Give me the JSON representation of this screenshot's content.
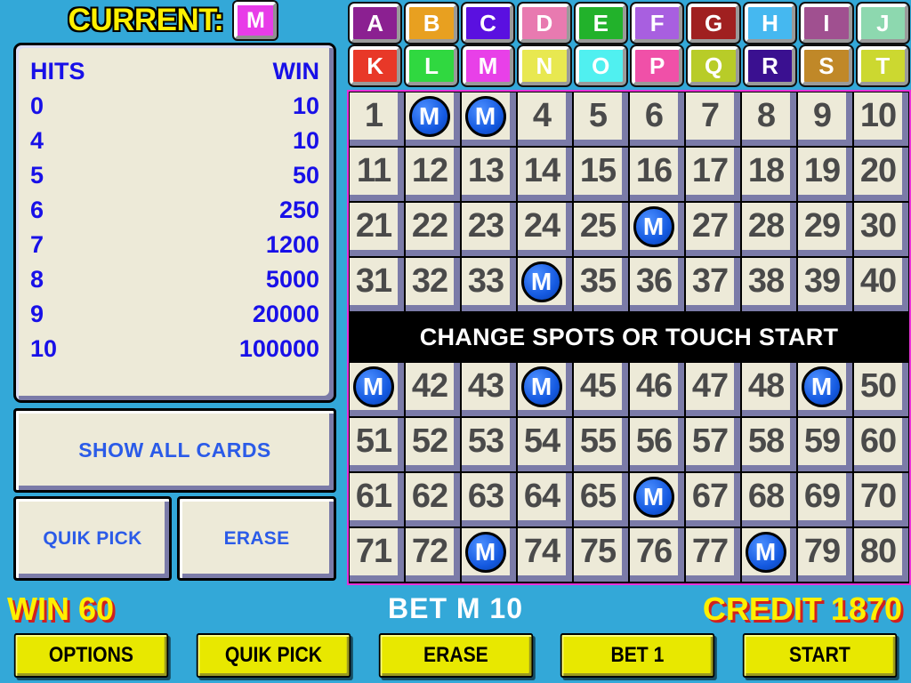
{
  "background_color": "#33A8D8",
  "header": {
    "current_label": "CURRENT:",
    "current_card": "M",
    "current_card_color": "#E83CE8"
  },
  "paytable": {
    "columns": [
      "HITS",
      "WIN"
    ],
    "rows": [
      {
        "hits": "0",
        "win": "10"
      },
      {
        "hits": "4",
        "win": "10"
      },
      {
        "hits": "5",
        "win": "50"
      },
      {
        "hits": "6",
        "win": "250"
      },
      {
        "hits": "7",
        "win": "1200"
      },
      {
        "hits": "8",
        "win": "5000"
      },
      {
        "hits": "9",
        "win": "20000"
      },
      {
        "hits": "10",
        "win": "100000"
      }
    ]
  },
  "left_buttons": {
    "show_all_cards": "SHOW ALL CARDS",
    "quik_pick": "QUIK PICK",
    "erase": "ERASE"
  },
  "card_letters": [
    {
      "label": "A",
      "color": "#8B2091"
    },
    {
      "label": "B",
      "color": "#E8A020"
    },
    {
      "label": "C",
      "color": "#5A10E0"
    },
    {
      "label": "D",
      "color": "#E87AB0"
    },
    {
      "label": "E",
      "color": "#22B22B"
    },
    {
      "label": "F",
      "color": "#A85FE0"
    },
    {
      "label": "G",
      "color": "#A02020"
    },
    {
      "label": "H",
      "color": "#45B8F0"
    },
    {
      "label": "I",
      "color": "#A05090"
    },
    {
      "label": "J",
      "color": "#8DD8AF"
    },
    {
      "label": "K",
      "color": "#E83828"
    },
    {
      "label": "L",
      "color": "#30D840"
    },
    {
      "label": "M",
      "color": "#E840E8"
    },
    {
      "label": "N",
      "color": "#E8E850"
    },
    {
      "label": "O",
      "color": "#50F0F0"
    },
    {
      "label": "P",
      "color": "#F050A8"
    },
    {
      "label": "Q",
      "color": "#B8CC28"
    },
    {
      "label": "R",
      "color": "#3A1090"
    },
    {
      "label": "S",
      "color": "#C08828"
    },
    {
      "label": "T",
      "color": "#CCD830"
    }
  ],
  "number_grid": {
    "total_spots": 80,
    "marker_letter": "M",
    "marker_color": "#1459E0",
    "selected": [
      2,
      3,
      26,
      34,
      41,
      44,
      49,
      66,
      73,
      78
    ],
    "selected_count": 10,
    "border_color": "#E830D8"
  },
  "message_bar": {
    "text": "CHANGE SPOTS OR TOUCH START",
    "background": "#000000",
    "color": "#FFFFFF"
  },
  "status_bar": {
    "win_label": "WIN",
    "win_value": "60",
    "win_text": "WIN 60",
    "bet_text": "BET  M  10",
    "bet_label": "BET",
    "bet_card": "M",
    "bet_value": "10",
    "credit_label": "CREDIT",
    "credit_value": "1870",
    "credit_text": "CREDIT 1870",
    "yellow": "#FFF000",
    "shadow_red": "#D02020"
  },
  "bottom_buttons": [
    {
      "label": "OPTIONS"
    },
    {
      "label": "QUIK PICK"
    },
    {
      "label": "ERASE"
    },
    {
      "label": "BET 1"
    },
    {
      "label": "START"
    }
  ]
}
